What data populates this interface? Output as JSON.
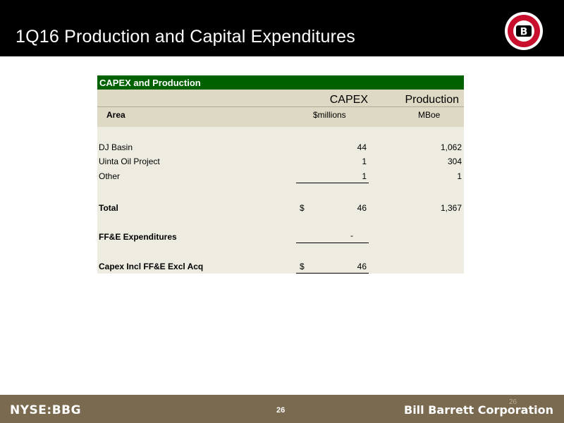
{
  "header": {
    "title": "1Q16 Production and Capital Expenditures",
    "logo_letter": "B"
  },
  "table": {
    "title": "CAPEX and Production",
    "col1_header": "CAPEX",
    "col2_header": "Production",
    "row_label_header": "Area",
    "col1_unit": "$millions",
    "col2_unit": "MBoe",
    "rows": [
      {
        "label": "DJ Basin",
        "capex": "44",
        "production": "1,062"
      },
      {
        "label": "Uinta Oil Project",
        "capex": "1",
        "production": "304"
      },
      {
        "label": "Other",
        "capex": "1",
        "production": "1"
      }
    ],
    "total": {
      "label": "Total",
      "dollar": "$",
      "capex": "46",
      "production": "1,367"
    },
    "ffe": {
      "label": "FF&E Expenditures",
      "capex": "-"
    },
    "capex_incl": {
      "label": "Capex Incl FF&E Excl Acq",
      "dollar": "$",
      "capex": "46"
    }
  },
  "footer": {
    "ticker": "NYSE:BBG",
    "page_number": "26",
    "page_number_ghost": "26",
    "company": "Bill Barrett Corporation"
  },
  "colors": {
    "header_bg": "#000000",
    "table_green": "#006100",
    "table_bg": "#eeece1",
    "footer_bg": "#7a6a4f",
    "logo_red": "#c8102e"
  }
}
